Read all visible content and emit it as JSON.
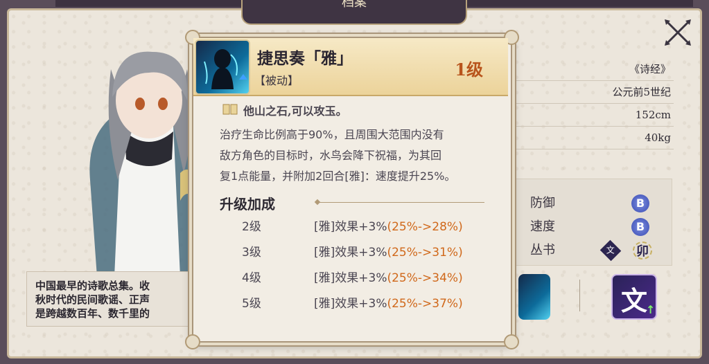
{
  "header": {
    "title": "档案"
  },
  "close": {
    "icon": "crossed-swords-close-icon"
  },
  "info": {
    "rows": [
      "《诗经》",
      "公元前5世纪",
      "152cm",
      "40kg"
    ]
  },
  "stats": {
    "rows": [
      {
        "label": "防御",
        "grade": "B"
      },
      {
        "label": "速度",
        "grade": "B"
      },
      {
        "label": "丛书",
        "tags": [
          "文",
          "卯"
        ]
      }
    ]
  },
  "description": {
    "lines": [
      "中国最早的诗歌总集。收",
      "秋时代的民间歌谣、正声",
      "是跨越数百年、数千里的"
    ]
  },
  "popup": {
    "skill_name": "捷思奏「雅」",
    "skill_type": "【被动】",
    "skill_level": "1级",
    "quote": "他山之石,可以攻玉。",
    "effect_lines": [
      "治疗生命比例高于90%，且周围大范围内没有",
      "敌方角色的目标时，水鸟会降下祝福，为其回",
      "复1点能量，并附加2回合[雅]：速度提升25%。"
    ],
    "upgrade_title": "升级加成",
    "upgrades": [
      {
        "level": "2级",
        "text": "[雅]效果+3%",
        "pct": "(25%->28%)"
      },
      {
        "level": "3级",
        "text": "[雅]效果+3%",
        "pct": "(25%->31%)"
      },
      {
        "level": "4级",
        "text": "[雅]效果+3%",
        "pct": "(25%->34%)"
      },
      {
        "level": "5级",
        "text": "[雅]效果+3%",
        "pct": "(25%->37%)"
      }
    ]
  },
  "bottom": {
    "icon_glyph": "文",
    "icon_arrow": "↑"
  }
}
